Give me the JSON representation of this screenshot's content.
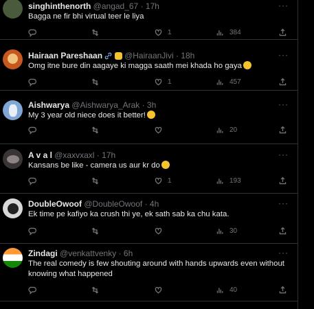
{
  "tweets": [
    {
      "name": "singhinthenorth",
      "handle": "@angad_67",
      "dot": "·",
      "time": "17h",
      "text": "Bagga ne fir bhi virtual teer le liya",
      "likes": "1",
      "views": "384",
      "avatar_color": "#4a5a3c",
      "has_emoji": false
    },
    {
      "name": "Hairaan Pareshaan",
      "handle": "@HairaanJivi",
      "dot": "·",
      "time": "18h",
      "text": "Omg itne bure din aagaye ki magga saath mei khada ho gaya",
      "likes": "1",
      "views": "457",
      "avatar_color": "#c4581f",
      "has_emoji": true
    },
    {
      "name": "Aishwarya",
      "handle": "@Aishwarya_Arak",
      "dot": "·",
      "time": "3h",
      "text": "My 3 year old niece does it better!",
      "likes": "",
      "views": "20",
      "avatar_color": "#7fa6d4",
      "has_emoji": true
    },
    {
      "name": "A v a l",
      "handle": "@xaxvxaxl",
      "dot": "·",
      "time": "17h",
      "text": "Kansans be like - camera us aur kr do",
      "likes": "1",
      "views": "193",
      "avatar_color": "#3a3535",
      "has_emoji": true
    },
    {
      "name": "DoubleOwoof",
      "handle": "@DoubleOwoof",
      "dot": "·",
      "time": "4h",
      "text": "Ek time pe kafiyo ka crush thi ye, ek sath sab ka chu kata.",
      "likes": "",
      "views": "30",
      "avatar_color": "#d8d8d8",
      "has_emoji": false
    },
    {
      "name": "Zindagi",
      "handle": "@venkattvenky",
      "dot": "·",
      "time": "6h",
      "text": "The real comedy is few shouting around with hands upwards even without knowing what happened",
      "likes": "",
      "views": "40",
      "avatar_color": "#ffffff",
      "has_emoji": false
    }
  ],
  "more_label": "···",
  "icons": [
    "reply-icon",
    "retweet-icon",
    "like-icon",
    "views-icon",
    "share-icon"
  ]
}
